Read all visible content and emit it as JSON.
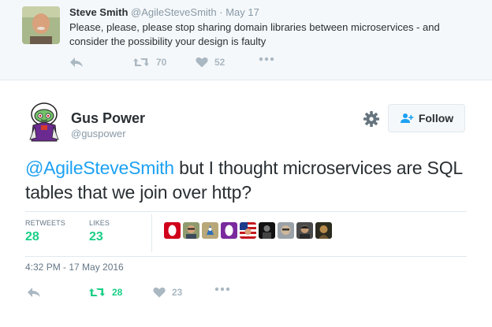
{
  "parent_tweet": {
    "author_name": "Steve Smith",
    "author_handle": "@AgileSteveSmith",
    "separator": "·",
    "date": "May 17",
    "text": "Please, please, please stop sharing domain libraries between microservices - and consider the possibility your design is faulty",
    "retweet_count": "70",
    "like_count": "52"
  },
  "main_tweet": {
    "author_name": "Gus Power",
    "author_handle": "@guspower",
    "follow_label": "Follow",
    "mention": "@AgileSteveSmith",
    "text": " but I thought microservices are SQL tables that we join over http?",
    "retweets_label": "RETWEETS",
    "retweets_value": "28",
    "likes_label": "LIKES",
    "likes_value": "23",
    "timestamp": "4:32 PM - 17 May 2016",
    "action_retweet_count": "28",
    "action_like_count": "23"
  },
  "colors": {
    "accent_blue": "#1da1f2",
    "retweet_green": "#19cf86",
    "muted_gray": "#8899a6"
  },
  "icons": {
    "reply": "reply-icon",
    "retweet": "retweet-icon",
    "like": "heart-icon",
    "more": "more-icon",
    "gear": "gear-icon",
    "follow": "follow-person-icon"
  }
}
